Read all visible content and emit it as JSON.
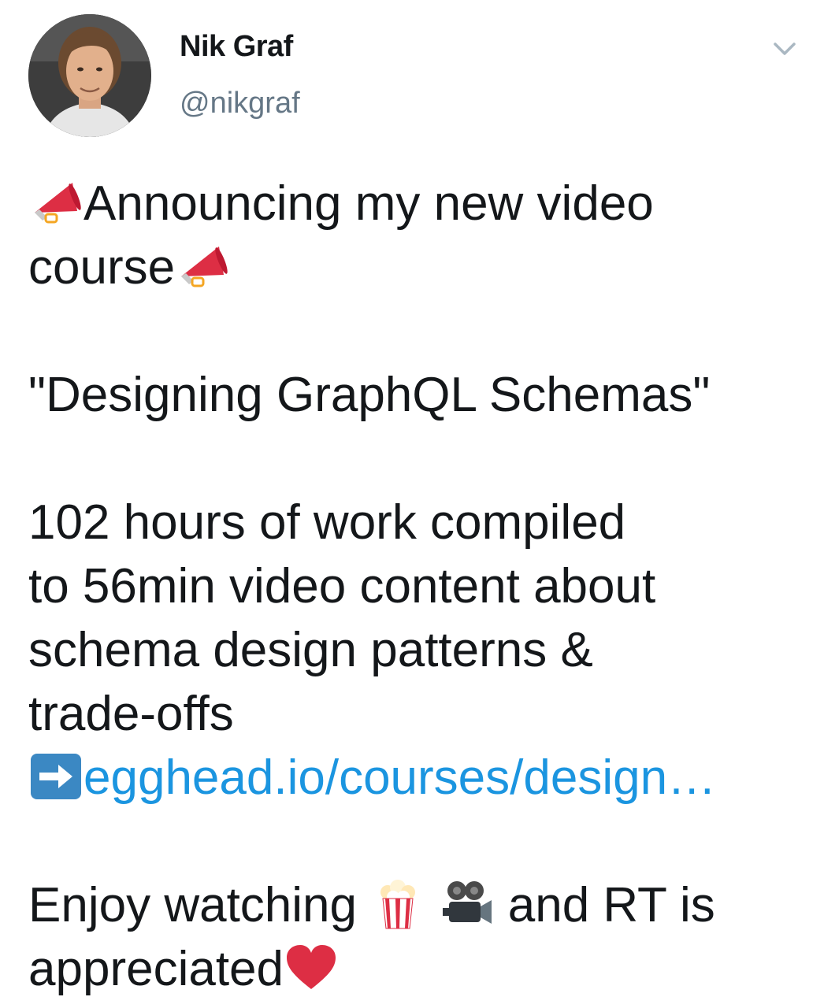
{
  "author": {
    "name": "Nik Graf",
    "handle": "@nikgraf"
  },
  "tweet": {
    "line1": "Announcing my new video",
    "line2": "course",
    "title": "\"Designing GraphQL Schemas\"",
    "desc1": "102 hours of work compiled",
    "desc2": "to 56min video content about",
    "desc3": "schema design patterns &",
    "desc4": "trade-offs",
    "link": "egghead.io/courses/design…",
    "enjoy_a": "Enjoy watching",
    "enjoy_b": "and RT is",
    "end": "appreciated"
  },
  "colors": {
    "text": "#14171a",
    "handle": "#657786",
    "link": "#1b95e0",
    "caret": "#aab8c2"
  },
  "icons": [
    "megaphone-icon",
    "right-arrow-icon",
    "popcorn-icon",
    "movie-camera-icon",
    "heart-icon",
    "chevron-down-icon"
  ]
}
